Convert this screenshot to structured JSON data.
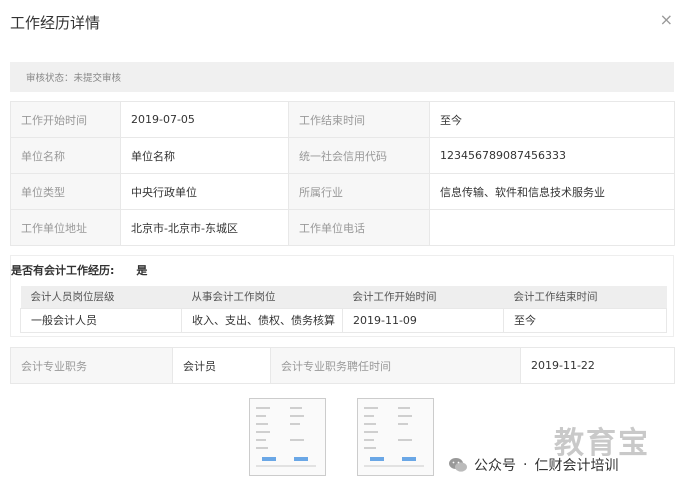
{
  "dialog": {
    "title": "工作经历详情",
    "close_label": "×"
  },
  "status": {
    "text": "审核状态：未提交审核"
  },
  "info": {
    "start_label": "工作开始时间",
    "start_value": "2019-07-05",
    "end_label": "工作结束时间",
    "end_value": "至今",
    "unit_label": "单位名称",
    "unit_value": "单位名称",
    "credit_label": "统一社会信用代码",
    "credit_value": "123456789087456333",
    "type_label": "单位类型",
    "type_value": "中央行政单位",
    "industry_label": "所属行业",
    "industry_value": "信息传输、软件和信息技术服务业",
    "address_label": "工作单位地址",
    "address_value": "北京市-北京市-东城区",
    "phone_label": "工作单位电话",
    "phone_value": ""
  },
  "accounting": {
    "question": "是否有会计工作经历:",
    "answer": "是",
    "headers": [
      "会计人员岗位层级",
      "从事会计工作岗位",
      "会计工作开始时间",
      "会计工作结束时间"
    ],
    "rows": [
      [
        "一般会计人员",
        "收入、支出、债权、债务核算",
        "2019-11-09",
        "至今"
      ]
    ]
  },
  "title_info": {
    "position_label": "会计专业职务",
    "position_value": "会计员",
    "appoint_label": "会计专业职务聘任时间",
    "appoint_value": "2019-11-22"
  },
  "watermark": {
    "account": "公众号",
    "dot": "·",
    "name": "仁财会计培训",
    "logo_text": "教育宝"
  },
  "icons": {
    "close": "close-icon",
    "wechat": "wechat-icon"
  },
  "colors": {
    "label_bg": "#f7f7f7",
    "status_bg": "#f0f0f0",
    "border": "#e8e8e8"
  }
}
